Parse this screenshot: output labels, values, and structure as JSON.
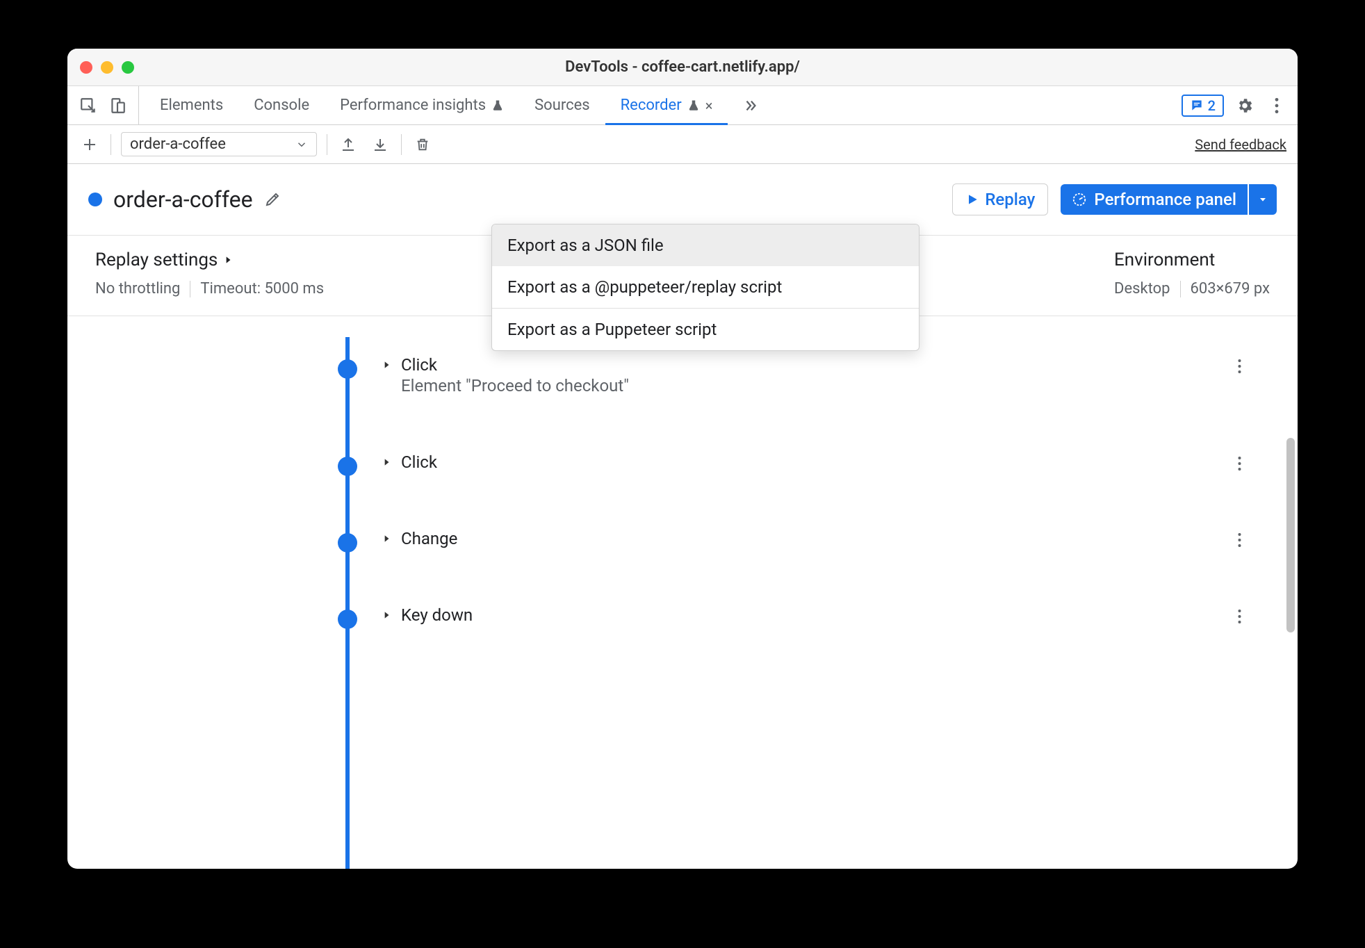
{
  "window": {
    "title": "DevTools - coffee-cart.netlify.app/"
  },
  "tabs": {
    "items": [
      "Elements",
      "Console",
      "Performance insights",
      "Sources",
      "Recorder"
    ],
    "active_index": 4,
    "issues_count": "2"
  },
  "toolbar": {
    "recording_name": "order-a-coffee",
    "feedback_label": "Send feedback"
  },
  "recorder": {
    "title": "order-a-coffee",
    "replay_label": "Replay",
    "perf_panel_label": "Performance panel"
  },
  "export_menu": {
    "items": [
      "Export as a JSON file",
      "Export as a @puppeteer/replay script",
      "Export as a Puppeteer script"
    ],
    "hover_index": 0
  },
  "settings": {
    "replay_heading": "Replay settings",
    "throttling": "No throttling",
    "timeout": "Timeout: 5000 ms",
    "env_heading": "Environment",
    "device": "Desktop",
    "viewport": "603×679 px"
  },
  "steps": [
    {
      "title": "Click",
      "subtitle": "Element \"Proceed to checkout\""
    },
    {
      "title": "Click",
      "subtitle": ""
    },
    {
      "title": "Change",
      "subtitle": ""
    },
    {
      "title": "Key down",
      "subtitle": ""
    }
  ]
}
